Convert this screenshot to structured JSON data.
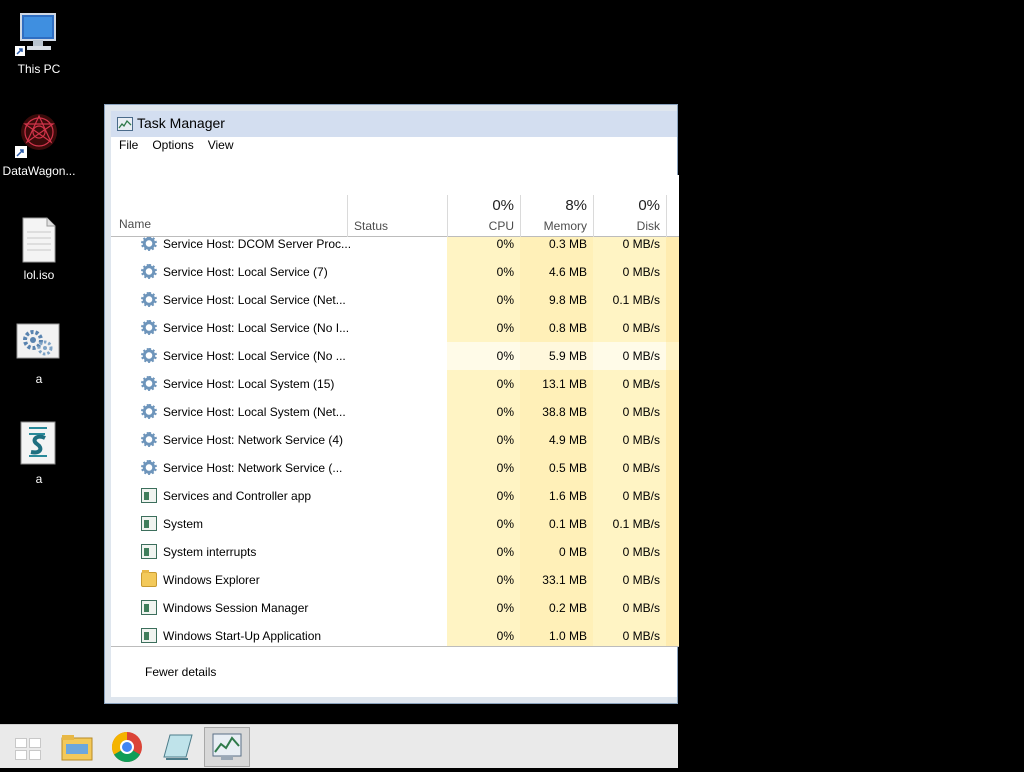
{
  "desktop": {
    "icons": [
      {
        "label": "This PC",
        "icon": "monitor-icon"
      },
      {
        "label": "DataWagon...",
        "icon": "datawagon-icon"
      },
      {
        "label": "lol.iso",
        "icon": "file-icon"
      },
      {
        "label": "a",
        "icon": "settings-file-icon"
      },
      {
        "label": "a",
        "icon": "script-file-icon"
      }
    ]
  },
  "window": {
    "title": "Task Manager",
    "menu": [
      "File",
      "Options",
      "View"
    ],
    "columns": {
      "name": "Name",
      "status": "Status",
      "cpu": {
        "label": "CPU",
        "percent": "0%"
      },
      "memory": {
        "label": "Memory",
        "percent": "8%"
      },
      "disk": {
        "label": "Disk",
        "percent": "0%"
      }
    },
    "rows": [
      {
        "name": "Service Host: DCOM Server Proc...",
        "icon": "gear-icon",
        "cpu": "0%",
        "memory": "0.3 MB",
        "disk": "0 MB/s"
      },
      {
        "name": "Service Host: Local Service (7)",
        "icon": "gear-icon",
        "cpu": "0%",
        "memory": "4.6 MB",
        "disk": "0 MB/s"
      },
      {
        "name": "Service Host: Local Service (Net...",
        "icon": "gear-icon",
        "cpu": "0%",
        "memory": "9.8 MB",
        "disk": "0.1 MB/s"
      },
      {
        "name": "Service Host: Local Service (No I...",
        "icon": "gear-icon",
        "cpu": "0%",
        "memory": "0.8 MB",
        "disk": "0 MB/s"
      },
      {
        "name": "Service Host: Local Service (No ...",
        "icon": "gear-icon",
        "cpu": "0%",
        "memory": "5.9 MB",
        "disk": "0 MB/s"
      },
      {
        "name": "Service Host: Local System (15)",
        "icon": "gear-icon",
        "cpu": "0%",
        "memory": "13.1 MB",
        "disk": "0 MB/s"
      },
      {
        "name": "Service Host: Local System (Net...",
        "icon": "gear-icon",
        "cpu": "0%",
        "memory": "38.8 MB",
        "disk": "0 MB/s"
      },
      {
        "name": "Service Host: Network Service (4)",
        "icon": "gear-icon",
        "cpu": "0%",
        "memory": "4.9 MB",
        "disk": "0 MB/s"
      },
      {
        "name": "Service Host: Network Service (...",
        "icon": "gear-icon",
        "cpu": "0%",
        "memory": "0.5 MB",
        "disk": "0 MB/s"
      },
      {
        "name": "Services and Controller app",
        "icon": "app-window-icon",
        "cpu": "0%",
        "memory": "1.6 MB",
        "disk": "0 MB/s"
      },
      {
        "name": "System",
        "icon": "app-window-icon",
        "cpu": "0%",
        "memory": "0.1 MB",
        "disk": "0.1 MB/s"
      },
      {
        "name": "System interrupts",
        "icon": "app-window-icon",
        "cpu": "0%",
        "memory": "0 MB",
        "disk": "0 MB/s"
      },
      {
        "name": "Windows Explorer",
        "icon": "folder-icon",
        "cpu": "0%",
        "memory": "33.1 MB",
        "disk": "0 MB/s"
      },
      {
        "name": "Windows Session Manager",
        "icon": "app-window-icon",
        "cpu": "0%",
        "memory": "0.2 MB",
        "disk": "0 MB/s"
      },
      {
        "name": "Windows Start-Up Application",
        "icon": "app-window-icon",
        "cpu": "0%",
        "memory": "1.0 MB",
        "disk": "0 MB/s"
      }
    ],
    "footer": {
      "fewer_details": "Fewer details"
    }
  },
  "taskbar": {
    "items": [
      {
        "icon": "start-icon"
      },
      {
        "icon": "file-explorer-icon"
      },
      {
        "icon": "chrome-icon"
      },
      {
        "icon": "notepad-icon"
      },
      {
        "icon": "task-manager-icon",
        "active": true
      }
    ]
  },
  "colors": {
    "cpu_heat": "#fff4c4",
    "memory_heat": "#fff0b8",
    "title_bar": "#d3def0"
  }
}
